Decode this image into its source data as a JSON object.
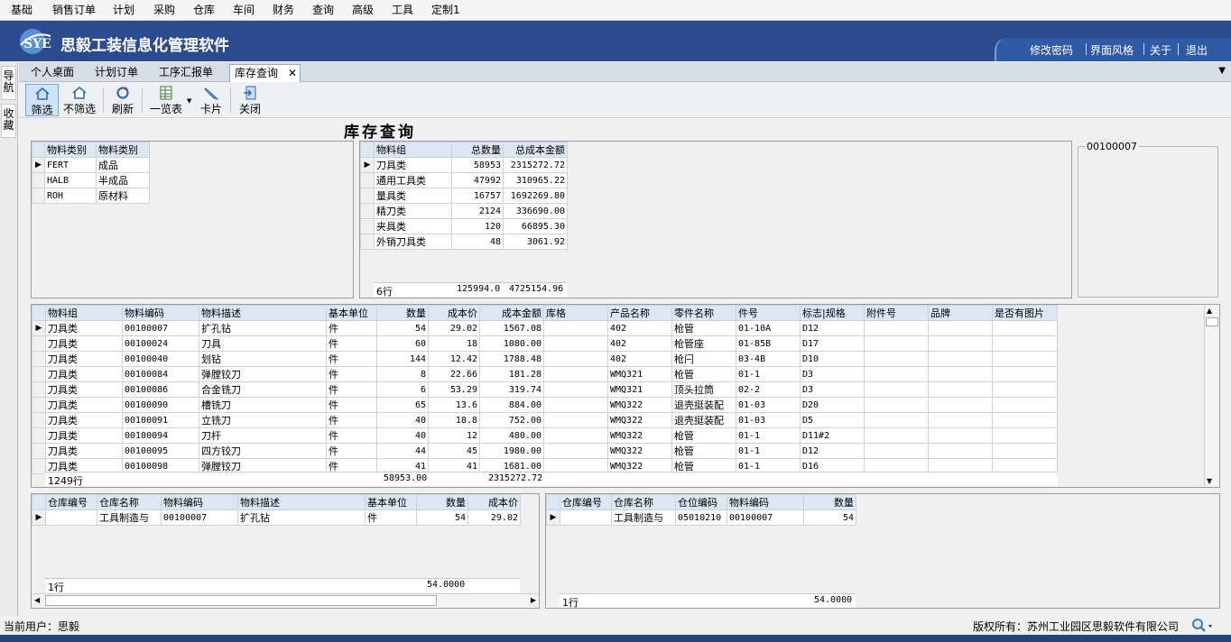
{
  "menu": [
    "基础",
    "销售订单",
    "计划",
    "采购",
    "仓库",
    "车间",
    "财务",
    "查询",
    "高级",
    "工具",
    "定制1"
  ],
  "app": {
    "title": "思毅工装信息化管理软件",
    "logo_text": "SYE",
    "links": [
      "修改密码",
      "界面风格",
      "关于",
      "退出"
    ]
  },
  "sidebar": [
    "导航",
    "收藏"
  ],
  "tabs": [
    "个人桌面",
    "计划订单",
    "工序汇报单",
    "库存查询"
  ],
  "close_glyph": "✕",
  "toolbar": [
    "筛选",
    "不筛选",
    "刷新",
    "一览表",
    "卡片",
    "关闭"
  ],
  "page_title": "库存查询",
  "category_grid": {
    "headers": [
      "物料类别",
      "物料类别"
    ],
    "rows": [
      [
        "FERT",
        "成品"
      ],
      [
        "HALB",
        "半成品"
      ],
      [
        "ROH",
        "原材料"
      ]
    ]
  },
  "group_grid": {
    "headers": [
      "物料组",
      "总数量",
      "总成本金额"
    ],
    "rows": [
      [
        "刀具类",
        "58953",
        "2315272.72"
      ],
      [
        "通用工具类",
        "47992",
        "310965.22"
      ],
      [
        "量具类",
        "16757",
        "1692269.80"
      ],
      [
        "精刀类",
        "2124",
        "336690.00"
      ],
      [
        "夹具类",
        "120",
        "66895.30"
      ],
      [
        "外销刀具类",
        "48",
        "3061.92"
      ]
    ],
    "footer": [
      "6行",
      "125994.0",
      "4725154.96"
    ]
  },
  "group_box_label": "00100007",
  "material_grid": {
    "headers": [
      "物料组",
      "物料编码",
      "物料描述",
      "基本单位",
      "数量",
      "成本价",
      "成本金额",
      "库格",
      "产品名称",
      "零件名称",
      "件号",
      "标志|规格",
      "附件号",
      "品牌",
      "是否有图片"
    ],
    "rows": [
      [
        "刀具类",
        "00100007",
        "扩孔钻",
        "件",
        "54",
        "29.02",
        "1567.08",
        "",
        "402",
        "枪管",
        "01-10A",
        "D12",
        "",
        "",
        ""
      ],
      [
        "刀具类",
        "00100024",
        "刀具",
        "件",
        "60",
        "18",
        "1080.00",
        "",
        "402",
        "枪管座",
        "01-85B",
        "D17",
        "",
        "",
        ""
      ],
      [
        "刀具类",
        "00100040",
        "划钻",
        "件",
        "144",
        "12.42",
        "1788.48",
        "",
        "402",
        "枪闩",
        "03-4B",
        "D10",
        "",
        "",
        ""
      ],
      [
        "刀具类",
        "00100084",
        "弹膛铰刀",
        "件",
        "8",
        "22.66",
        "181.28",
        "",
        "WMQ321",
        "枪管",
        "01-1",
        "D3",
        "",
        "",
        ""
      ],
      [
        "刀具类",
        "00100086",
        "合金铣刀",
        "件",
        "6",
        "53.29",
        "319.74",
        "",
        "WMQ321",
        "顶头拉筒",
        "02-2",
        "D3",
        "",
        "",
        ""
      ],
      [
        "刀具类",
        "00100090",
        "槽铣刀",
        "件",
        "65",
        "13.6",
        "884.00",
        "",
        "WMQ322",
        "退壳挺装配",
        "01-03",
        "D20",
        "",
        "",
        ""
      ],
      [
        "刀具类",
        "00100091",
        "立铣刀",
        "件",
        "40",
        "18.8",
        "752.00",
        "",
        "WMQ322",
        "退壳挺装配",
        "01-03",
        "D5",
        "",
        "",
        ""
      ],
      [
        "刀具类",
        "00100094",
        "刀杆",
        "件",
        "40",
        "12",
        "480.00",
        "",
        "WMQ322",
        "枪管",
        "01-1",
        "D11#2",
        "",
        "",
        ""
      ],
      [
        "刀具类",
        "00100095",
        "四方铰刀",
        "件",
        "44",
        "45",
        "1980.00",
        "",
        "WMQ322",
        "枪管",
        "01-1",
        "D12",
        "",
        "",
        ""
      ],
      [
        "刀具类",
        "00100098",
        "弹膛铰刀",
        "件",
        "41",
        "41",
        "1681.00",
        "",
        "WMQ322",
        "枪管",
        "01-1",
        "D16",
        "",
        "",
        ""
      ]
    ],
    "footer": [
      "1249行",
      "58953.00",
      "2315272.72"
    ]
  },
  "warehouse_grid": {
    "headers": [
      "仓库编号",
      "仓库名称",
      "物料编码",
      "物料描述",
      "基本单位",
      "数量",
      "成本价"
    ],
    "rows": [
      [
        "",
        "工具制造与",
        "00100007",
        "扩孔钻",
        "件",
        "54",
        "29.02"
      ]
    ],
    "footer": [
      "1行",
      "54.0000"
    ]
  },
  "location_grid": {
    "headers": [
      "仓库编号",
      "仓库名称",
      "仓位编码",
      "物料编码",
      "数量"
    ],
    "rows": [
      [
        "",
        "工具制造与",
        "05010210",
        "00100007",
        "54"
      ]
    ],
    "footer": [
      "1行",
      "54.0000"
    ]
  },
  "status": {
    "user": "当前用户：思毅",
    "copyright": "版权所有：苏州工业园区思毅软件有限公司"
  },
  "colors": {
    "banner": "#2b4b8e",
    "header_cell": "#dde7f3"
  }
}
